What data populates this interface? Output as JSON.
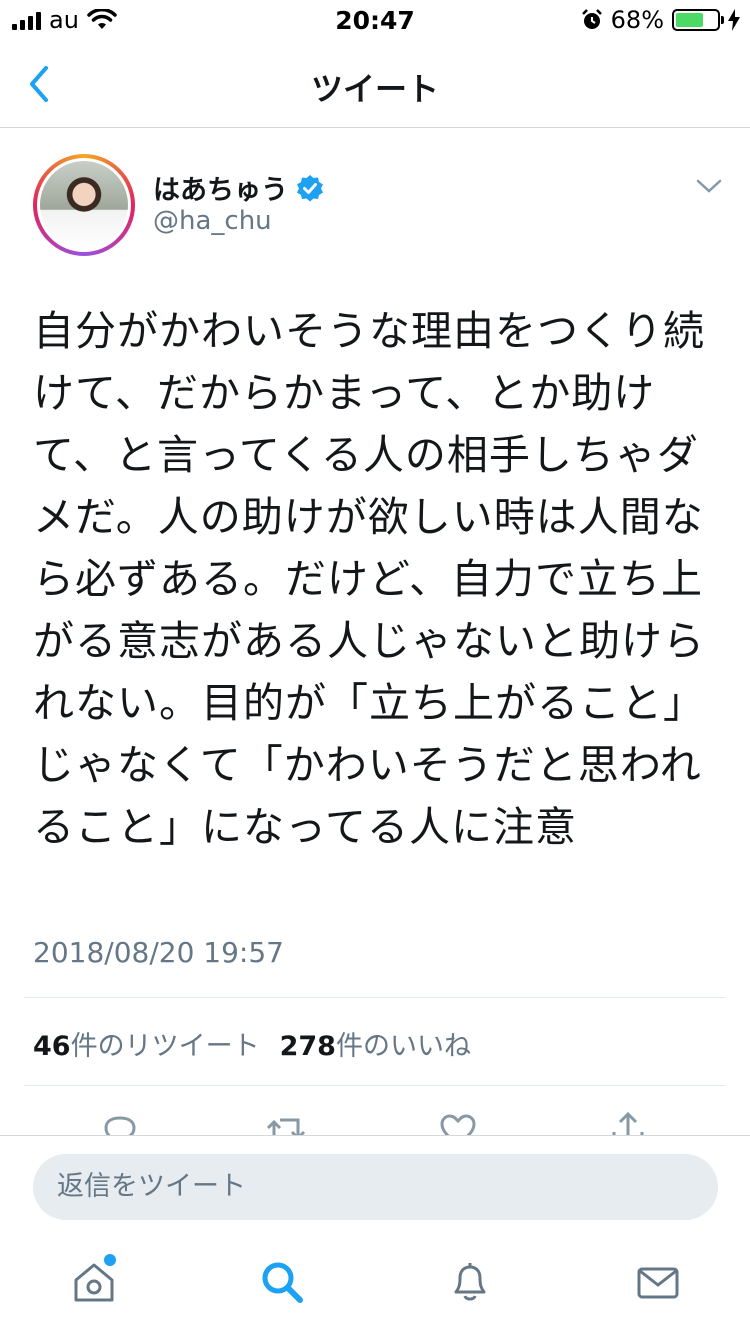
{
  "status_bar": {
    "carrier": "au",
    "time": "20:47",
    "battery_percent": "68%",
    "battery_level": 0.68
  },
  "nav": {
    "title": "ツイート"
  },
  "tweet": {
    "user_name": "はあちゅう",
    "handle": "@ha_chu",
    "verified": true,
    "text": "自分がかわいそうな理由をつくり続けて、だからかまって、とか助けて、と言ってくる人の相手しちゃダメだ。人の助けが欲しい時は人間なら必ずある。だけど、自力で立ち上がる意志がある人じゃないと助けられない。目的が「立ち上がること」じゃなくて「かわいそうだと思われること」になってる人に注意",
    "timestamp": "2018/08/20 19:57",
    "retweet_count": "46",
    "retweet_label": "件のリツイート",
    "like_count": "278",
    "like_label": "件のいいね"
  },
  "reply": {
    "placeholder": "返信をツイート"
  },
  "tabs": [
    {
      "icon": "home-icon",
      "has_notification_dot": true
    },
    {
      "icon": "search-icon",
      "active": true
    },
    {
      "icon": "bell-icon"
    },
    {
      "icon": "mail-icon"
    }
  ],
  "colors": {
    "accent": "#1da1f2",
    "secondary_text": "#657786",
    "battery": "#4cd964"
  }
}
